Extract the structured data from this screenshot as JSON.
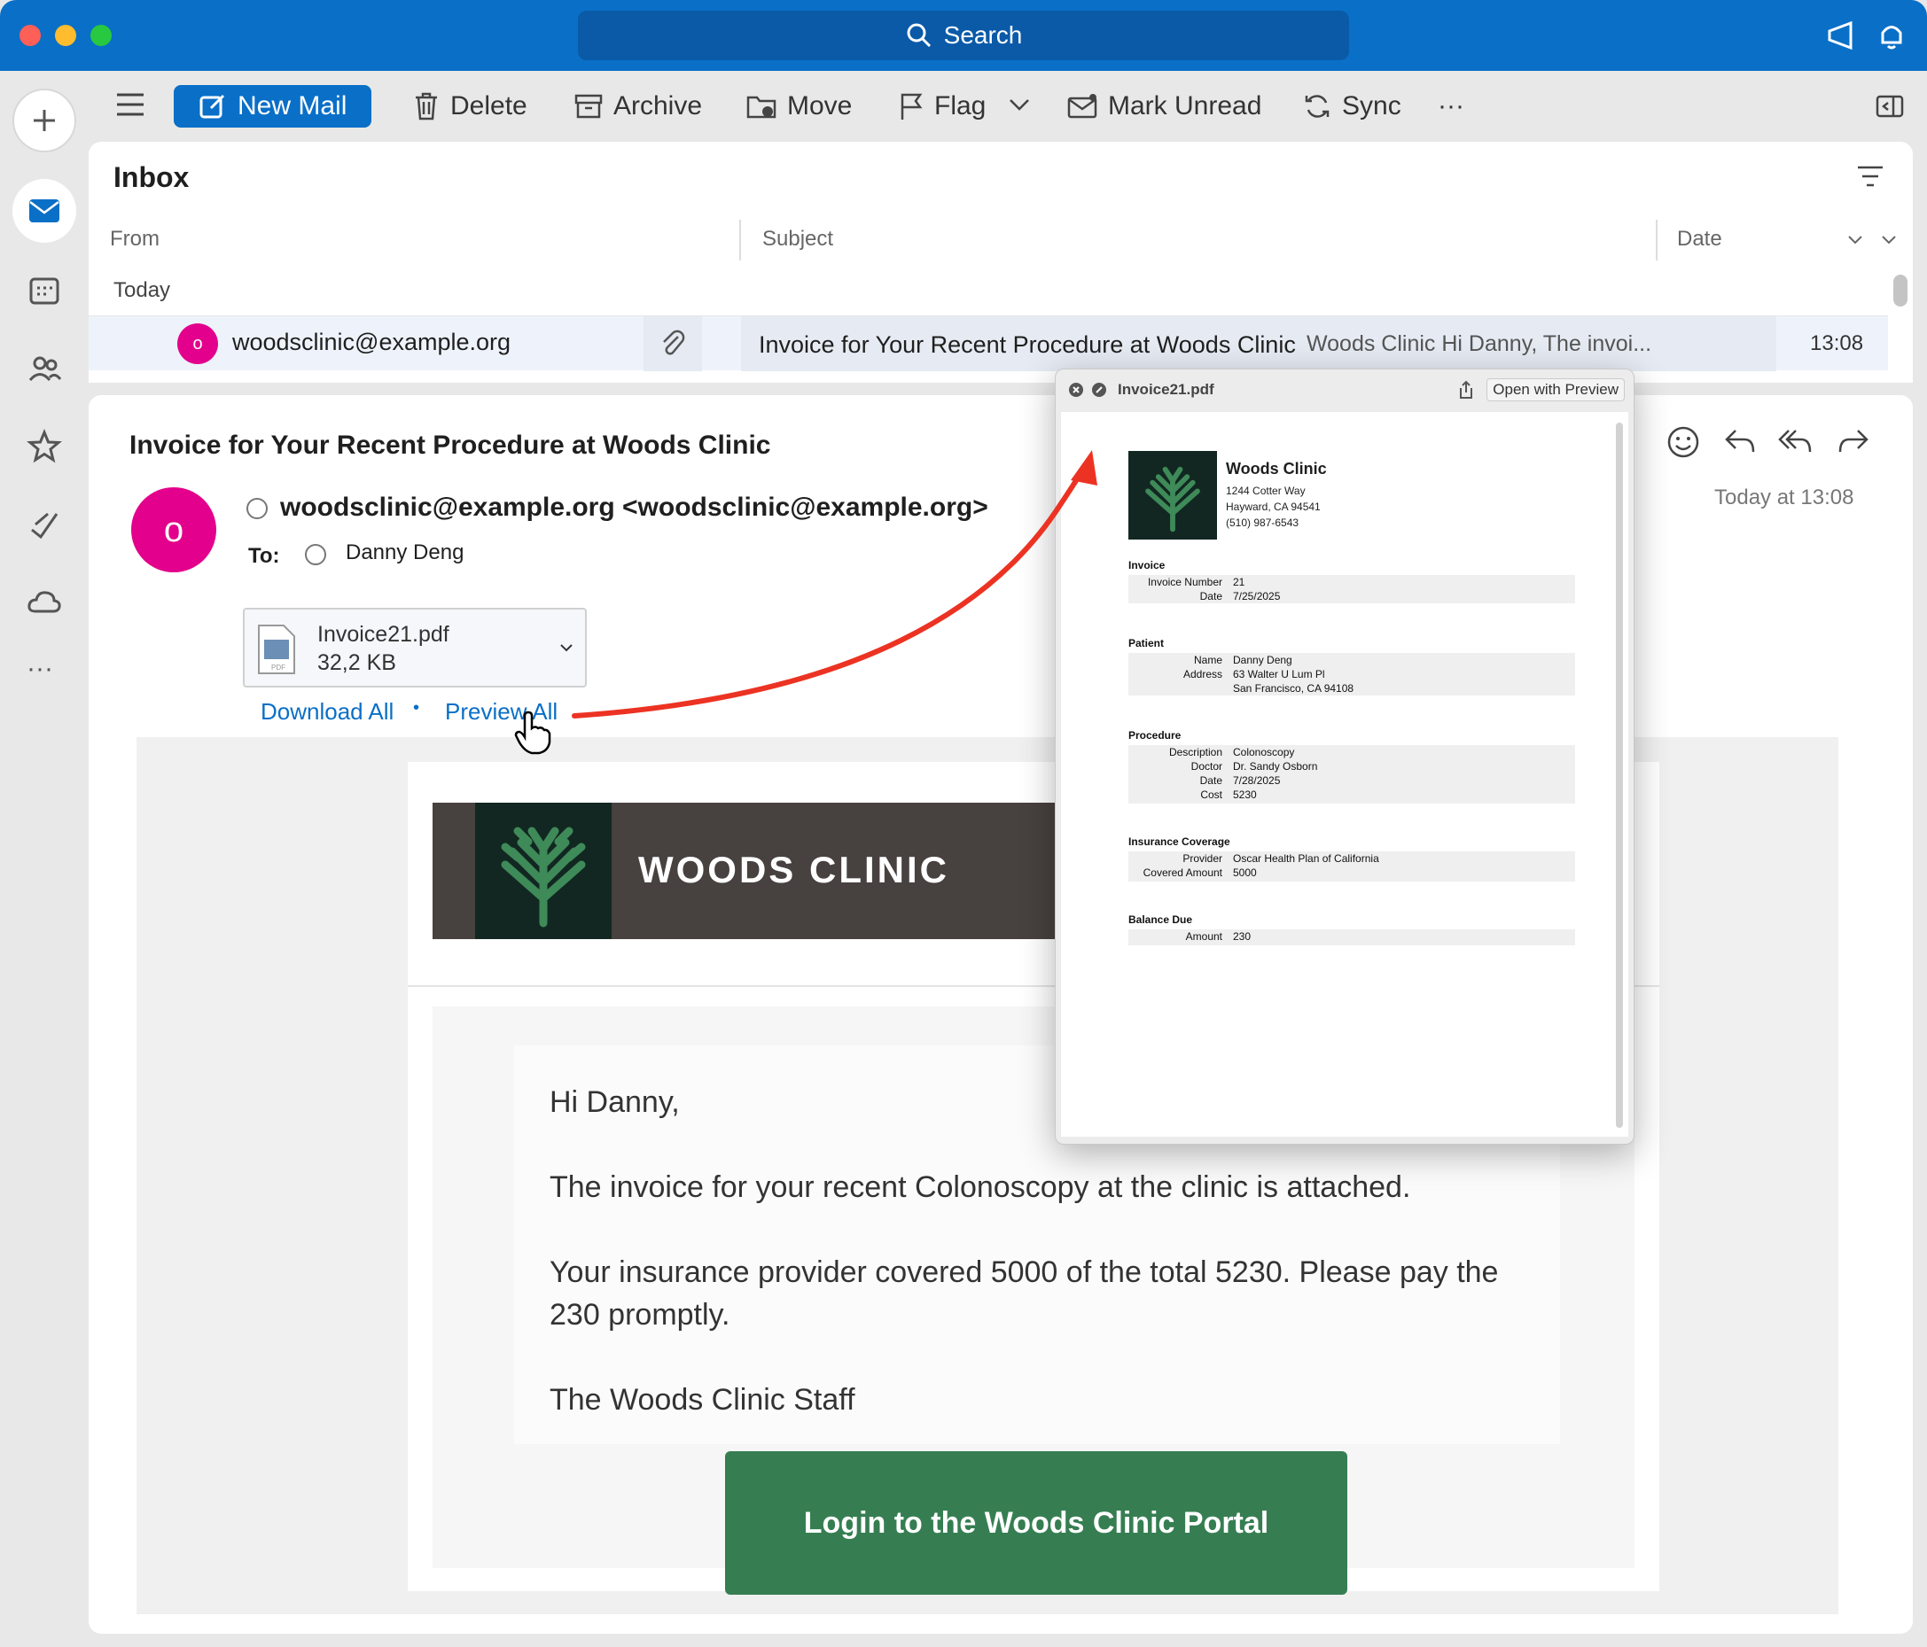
{
  "titlebar": {
    "search_label": "Search"
  },
  "toolbar": {
    "new_mail": "New Mail",
    "delete": "Delete",
    "archive": "Archive",
    "move": "Move",
    "flag": "Flag",
    "mark_unread": "Mark Unread",
    "sync": "Sync",
    "more": "···"
  },
  "rail": {
    "more": "···"
  },
  "inbox": {
    "title": "Inbox",
    "columns": {
      "from": "From",
      "subject": "Subject",
      "date": "Date"
    },
    "group": "Today",
    "row": {
      "avatar_letter": "o",
      "from": "woodsclinic@example.org",
      "subject": "Invoice for Your Recent Procedure at Woods Clinic",
      "preview": "Woods Clinic Hi Danny, The invoi...",
      "time": "13:08"
    }
  },
  "message": {
    "subject": "Invoice for Your Recent Procedure at Woods Clinic",
    "avatar_letter": "o",
    "sender": "woodsclinic@example.org <woodsclinic@example.org>",
    "to_label": "To:",
    "to": "Danny Deng",
    "date": "Today at 13:08",
    "attachment": {
      "name": "Invoice21.pdf",
      "size": "32,2 KB"
    },
    "download_all": "Download All",
    "dot": "•",
    "preview_all": "Preview All",
    "banner_title": "WOODS CLINIC",
    "body": {
      "greeting": "Hi Danny,",
      "p1": "The invoice for your recent Colonoscopy at the clinic is attached.",
      "p2a": "Your insurance provider covered 5000 of the total 5230. Please pay the",
      "p2b": "230 promptly.",
      "sign": "The Woods Clinic Staff"
    },
    "cta": "Login to the Woods Clinic Portal"
  },
  "quicklook": {
    "filename": "Invoice21.pdf",
    "open_with": "Open with Preview",
    "clinic": {
      "name": "Woods Clinic",
      "addr1": "1244 Cotter Way",
      "addr2": "Hayward, CA 94541",
      "phone": "(510) 987-6543"
    },
    "invoice": {
      "title": "Invoice",
      "number_label": "Invoice Number",
      "number": "21",
      "date_label": "Date",
      "date": "7/25/2025"
    },
    "patient": {
      "title": "Patient",
      "name_label": "Name",
      "name": "Danny Deng",
      "address_label": "Address",
      "address1": "63 Walter U Lum Pl",
      "address2": "San Francisco, CA 94108"
    },
    "procedure": {
      "title": "Procedure",
      "desc_label": "Description",
      "desc": "Colonoscopy",
      "doctor_label": "Doctor",
      "doctor": "Dr. Sandy Osborn",
      "date_label": "Date",
      "date": "7/28/2025",
      "cost_label": "Cost",
      "cost": "5230"
    },
    "insurance": {
      "title": "Insurance Coverage",
      "provider_label": "Provider",
      "provider": "Oscar Health Plan of California",
      "covered_label": "Covered Amount",
      "covered": "5000"
    },
    "balance": {
      "title": "Balance Due",
      "amount_label": "Amount",
      "amount": "230"
    }
  },
  "colors": {
    "accent": "#0a6fc7",
    "avatar": "#e3008c",
    "cta": "#367e52",
    "banner": "#47413f",
    "arrow": "#ec3323"
  }
}
